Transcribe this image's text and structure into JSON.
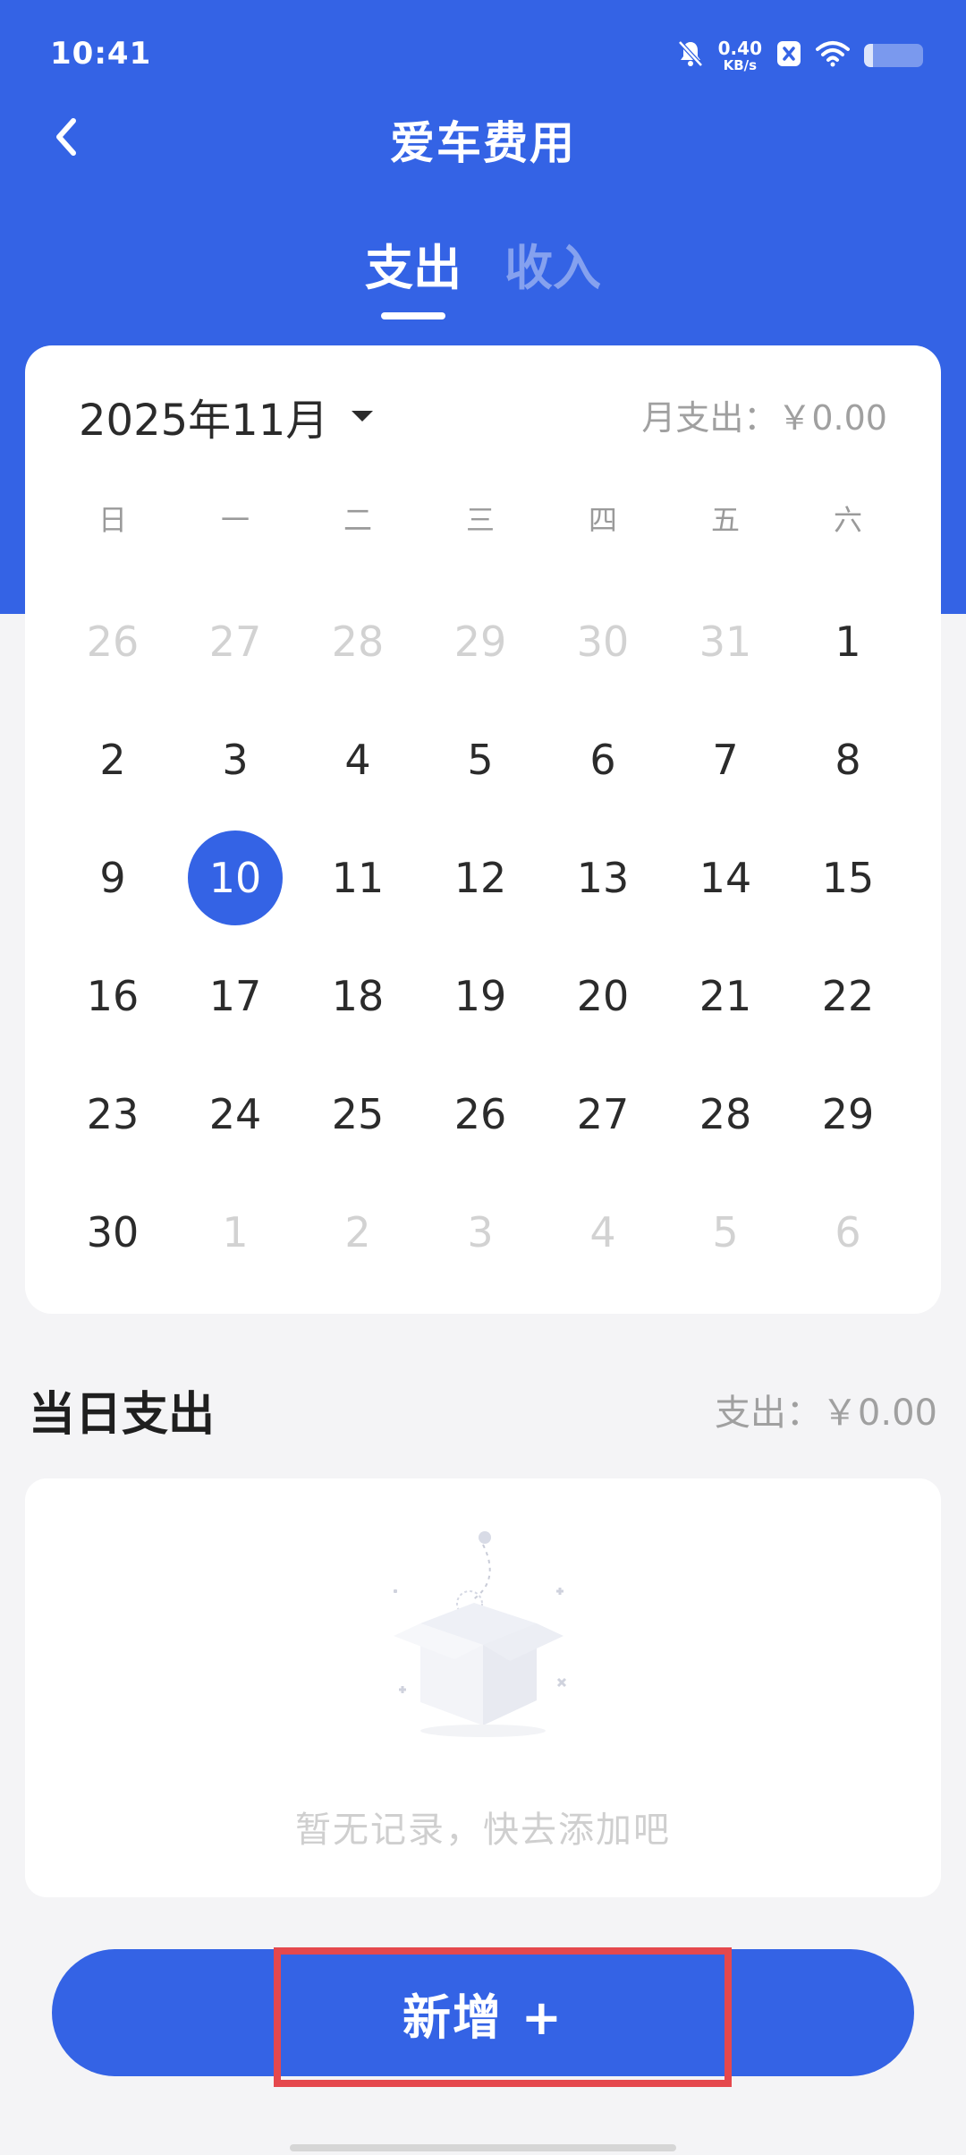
{
  "status_bar": {
    "time": "10:41",
    "net_speed_value": "0.40",
    "net_speed_unit": "KB/s",
    "icons": [
      "mute-bell-icon",
      "x-box-icon",
      "wifi-icon",
      "battery-icon"
    ],
    "battery_level": 0.15
  },
  "header": {
    "title": "爱车费用",
    "back_icon": "chevron-left-icon"
  },
  "tabs": [
    {
      "label": "支出",
      "active": true
    },
    {
      "label": "收入",
      "active": false
    }
  ],
  "calendar": {
    "month_label": "2025年11月",
    "month_total": "月支出：￥0.00",
    "weekdays": [
      "日",
      "一",
      "二",
      "三",
      "四",
      "五",
      "六"
    ],
    "weeks": [
      [
        {
          "d": "26",
          "o": true
        },
        {
          "d": "27",
          "o": true
        },
        {
          "d": "28",
          "o": true
        },
        {
          "d": "29",
          "o": true
        },
        {
          "d": "30",
          "o": true
        },
        {
          "d": "31",
          "o": true
        },
        {
          "d": "1",
          "o": false
        }
      ],
      [
        {
          "d": "2",
          "o": false
        },
        {
          "d": "3",
          "o": false
        },
        {
          "d": "4",
          "o": false
        },
        {
          "d": "5",
          "o": false
        },
        {
          "d": "6",
          "o": false
        },
        {
          "d": "7",
          "o": false
        },
        {
          "d": "8",
          "o": false
        }
      ],
      [
        {
          "d": "9",
          "o": false
        },
        {
          "d": "10",
          "o": false,
          "selected": true
        },
        {
          "d": "11",
          "o": false
        },
        {
          "d": "12",
          "o": false
        },
        {
          "d": "13",
          "o": false
        },
        {
          "d": "14",
          "o": false
        },
        {
          "d": "15",
          "o": false
        }
      ],
      [
        {
          "d": "16",
          "o": false
        },
        {
          "d": "17",
          "o": false
        },
        {
          "d": "18",
          "o": false
        },
        {
          "d": "19",
          "o": false
        },
        {
          "d": "20",
          "o": false
        },
        {
          "d": "21",
          "o": false
        },
        {
          "d": "22",
          "o": false
        }
      ],
      [
        {
          "d": "23",
          "o": false
        },
        {
          "d": "24",
          "o": false
        },
        {
          "d": "25",
          "o": false
        },
        {
          "d": "26",
          "o": false
        },
        {
          "d": "27",
          "o": false
        },
        {
          "d": "28",
          "o": false
        },
        {
          "d": "29",
          "o": false
        }
      ],
      [
        {
          "d": "30",
          "o": false
        },
        {
          "d": "1",
          "o": true
        },
        {
          "d": "2",
          "o": true
        },
        {
          "d": "3",
          "o": true
        },
        {
          "d": "4",
          "o": true
        },
        {
          "d": "5",
          "o": true
        },
        {
          "d": "6",
          "o": true
        }
      ]
    ]
  },
  "daily": {
    "title": "当日支出",
    "total": "支出：￥0.00",
    "empty_text": "暂无记录，快去添加吧",
    "empty_icon": "empty-box-icon"
  },
  "add_button": {
    "label": "新增 +"
  },
  "colors": {
    "accent": "#3463e5",
    "highlight": "#e5484d"
  }
}
